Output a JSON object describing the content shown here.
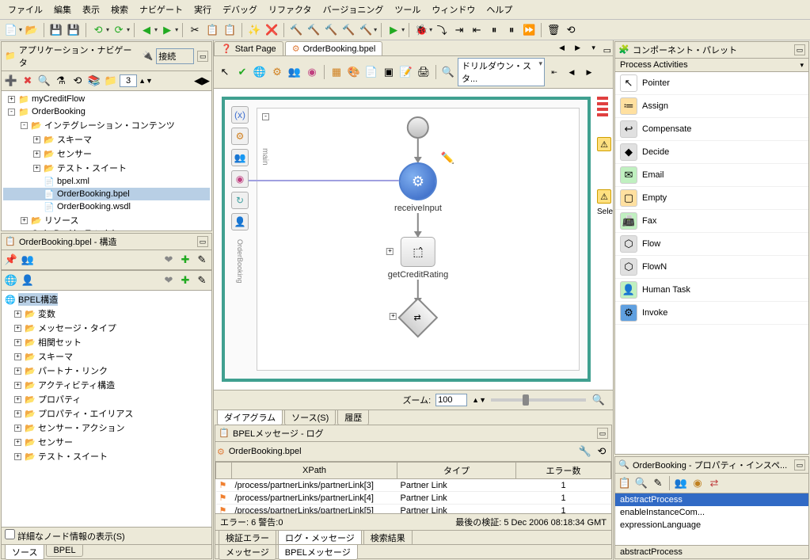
{
  "menu": [
    "ファイル",
    "編集",
    "表示",
    "検索",
    "ナビゲート",
    "実行",
    "デバッグ",
    "リファクタ",
    "バージョニング",
    "ツール",
    "ウィンドウ",
    "ヘルプ"
  ],
  "navigator": {
    "title": "アプリケーション・ナビゲータ",
    "connect_label": "接続",
    "page_value": "3",
    "tree": [
      {
        "indent": 0,
        "toggle": "+",
        "icon": "📁",
        "label": "myCreditFlow"
      },
      {
        "indent": 0,
        "toggle": "-",
        "icon": "📁",
        "label": "OrderBooking"
      },
      {
        "indent": 1,
        "toggle": "-",
        "icon": "📂",
        "label": "インテグレーション・コンテンツ"
      },
      {
        "indent": 2,
        "toggle": "+",
        "icon": "📂",
        "label": "スキーマ"
      },
      {
        "indent": 2,
        "toggle": "+",
        "icon": "📂",
        "label": "センサー"
      },
      {
        "indent": 2,
        "toggle": "+",
        "icon": "📂",
        "label": "テスト・スイート"
      },
      {
        "indent": 2,
        "toggle": "",
        "icon": "📄",
        "label": "bpel.xml"
      },
      {
        "indent": 2,
        "toggle": "",
        "icon": "📄",
        "label": "OrderBooking.bpel",
        "selected": true
      },
      {
        "indent": 2,
        "toggle": "",
        "icon": "📄",
        "label": "OrderBooking.wsdl"
      },
      {
        "indent": 1,
        "toggle": "+",
        "icon": "📂",
        "label": "リソース"
      },
      {
        "indent": 0,
        "toggle": "+",
        "icon": "📁",
        "label": "OrderBookingTutorial"
      }
    ]
  },
  "structure": {
    "title": "OrderBooking.bpel - 構造",
    "root": "BPEL構造",
    "items": [
      "変数",
      "メッセージ・タイプ",
      "相関セット",
      "スキーマ",
      "パートナ・リンク",
      "アクティビティ構造",
      "プロパティ",
      "プロパティ・エイリアス",
      "センサー・アクション",
      "センサー",
      "テスト・スイート"
    ],
    "detail_checkbox": "詳細なノード情報の表示(S)",
    "bottom_tabs": [
      "ソース",
      "BPEL"
    ]
  },
  "editor": {
    "tabs": [
      {
        "icon": "❓",
        "label": "Start Page"
      },
      {
        "icon": "⚙",
        "label": "OrderBooking.bpel",
        "active": true
      }
    ],
    "drilldown_label": "ドリルダウン・スタ...",
    "nodes": {
      "receive": "receiveInput",
      "credit": "getCreditRating"
    },
    "sele_label": "Sele",
    "swim": "main",
    "ob_vert": "OrderBooking",
    "zoom_label": "ズーム:",
    "zoom_value": "100",
    "bottom_tabs": [
      "ダイアグラム",
      "ソース(S)",
      "履歴"
    ]
  },
  "palette": {
    "title": "コンポーネント・パレット",
    "category": "Process Activities",
    "items": [
      {
        "icon": "↖",
        "bg": "#fff",
        "label": "Pointer"
      },
      {
        "icon": "≔",
        "bg": "#ffe0a0",
        "label": "Assign"
      },
      {
        "icon": "↩",
        "bg": "#e0e0e0",
        "label": "Compensate"
      },
      {
        "icon": "◆",
        "bg": "#e0e0e0",
        "label": "Decide"
      },
      {
        "icon": "✉",
        "bg": "#c0f0c0",
        "label": "Email"
      },
      {
        "icon": "▢",
        "bg": "#ffe0a0",
        "label": "Empty"
      },
      {
        "icon": "📠",
        "bg": "#c0f0c0",
        "label": "Fax"
      },
      {
        "icon": "⬡",
        "bg": "#e0e0e0",
        "label": "Flow"
      },
      {
        "icon": "⬡",
        "bg": "#e0e0e0",
        "label": "FlowN"
      },
      {
        "icon": "👤",
        "bg": "#c0f0c0",
        "label": "Human Task"
      },
      {
        "icon": "⚙",
        "bg": "#60a0e0",
        "label": "Invoke"
      }
    ]
  },
  "inspector": {
    "title": "OrderBooking - プロパティ・インスペ...",
    "props": [
      "abstractProcess",
      "enableInstanceCom...",
      "expressionLanguage"
    ],
    "selected_label": "abstractProcess"
  },
  "messages": {
    "title": "BPELメッセージ - ログ",
    "file": "OrderBooking.bpel",
    "columns": [
      "XPath",
      "タイプ",
      "エラー数"
    ],
    "rows": [
      {
        "xpath": "/process/partnerLinks/partnerLink[3]",
        "type": "Partner Link",
        "count": "1"
      },
      {
        "xpath": "/process/partnerLinks/partnerLink[4]",
        "type": "Partner Link",
        "count": "1"
      },
      {
        "xpath": "/process/partnerLinks/partnerLink[5]",
        "type": "Partner Link",
        "count": "1"
      }
    ],
    "summary": "エラー: 6 警告:0",
    "last_check": "最後の検証: 5 Dec 2006 08:18:34 GMT",
    "tabs": [
      "検証エラー",
      "ログ・メッセージ",
      "検索結果"
    ],
    "outer_tabs": [
      "メッセージ",
      "BPELメッセージ"
    ]
  }
}
